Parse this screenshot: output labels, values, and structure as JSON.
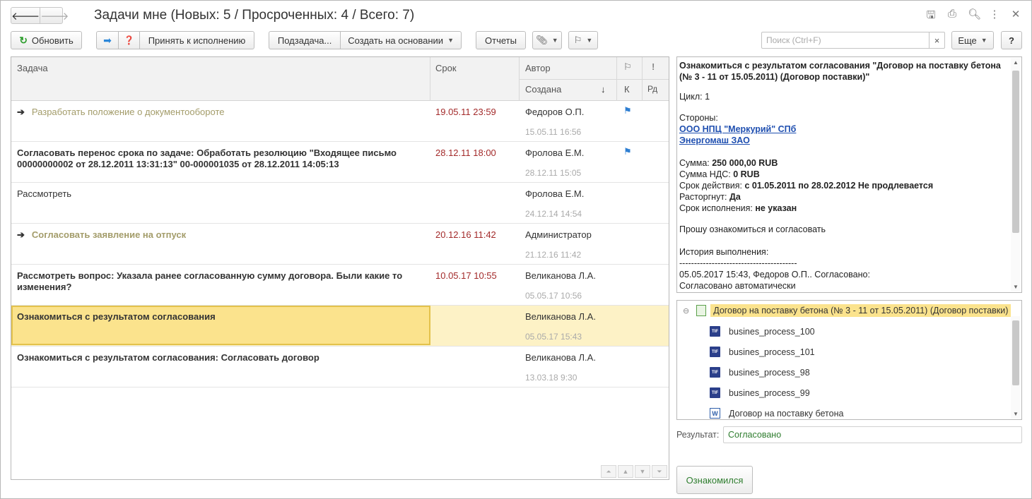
{
  "window": {
    "title": "Задачи мне (Новых: 5 / Просроченных: 4 / Всего: 7)",
    "icons": [
      "save-icon",
      "print-icon",
      "preview-icon",
      "more-vertical-icon",
      "close-icon"
    ]
  },
  "toolbar": {
    "refresh": "Обновить",
    "accept": "Принять к исполнению",
    "subtask": "Подзадача...",
    "create_based": "Создать на основании",
    "reports": "Отчеты",
    "search_placeholder": "Поиск (Ctrl+F)",
    "search_clear": "×",
    "more": "Еще",
    "help": "?"
  },
  "table": {
    "headers": {
      "task": "Задача",
      "due": "Срок",
      "author": "Автор",
      "created": "Создана",
      "sort_indicator": "↓",
      "control": "К",
      "exclaim": "!",
      "rd": "Рд"
    },
    "rows": [
      {
        "task": "Разработать положение о документообороте",
        "due": "19.05.11 23:59",
        "author": "Федоров О.П.",
        "created": "15.05.11 16:56",
        "flag": true,
        "style": "new",
        "arrow": true
      },
      {
        "task": "Согласовать перенос срока по задаче: Обработать резолюцию \"Входящее письмо 00000000002 от 28.12.2011 13:31:13\" 00-000001035 от 28.12.2011 14:05:13",
        "due": "28.12.11 18:00",
        "author": "Фролова Е.М.",
        "created": "28.12.11 15:05",
        "flag": true,
        "style": "bold",
        "arrow": false
      },
      {
        "task": "Рассмотреть",
        "due": "",
        "author": "Фролова Е.М.",
        "created": "24.12.14 14:54",
        "flag": false,
        "style": "normal",
        "arrow": false
      },
      {
        "task": "Согласовать заявление на отпуск",
        "due": "20.12.16 11:42",
        "author": "Администратор",
        "created": "21.12.16 11:42",
        "flag": false,
        "style": "newbold",
        "arrow": true
      },
      {
        "task": "Рассмотреть вопрос: Указала ранее согласованную сумму договора. Были какие то изменения?",
        "due": "10.05.17 10:55",
        "author": "Великанова Л.А.",
        "created": "05.05.17 10:56",
        "flag": false,
        "style": "bold",
        "arrow": false
      },
      {
        "task": "Ознакомиться с результатом согласования",
        "due": "",
        "author": "Великанова Л.А.",
        "created": "05.05.17 15:43",
        "flag": false,
        "style": "bold",
        "arrow": false,
        "selected": true
      },
      {
        "task": "Ознакомиться с результатом согласования: Согласовать договор",
        "due": "",
        "author": "Великанова Л.А.",
        "created": "13.03.18 9:30",
        "flag": false,
        "style": "bold",
        "arrow": false
      }
    ]
  },
  "details": {
    "title": "Ознакомиться с результатом согласования \"Договор на поставку бетона (№ 3 - 11 от 15.05.2011) (Договор поставки)\"",
    "cycle_label": "Цикл:",
    "cycle_value": "1",
    "parties_label": "Стороны:",
    "party1": "ООО НПЦ \"Меркурий\" СПб",
    "party2": "Энергомаш ЗАО",
    "sum_label": "Сумма:",
    "sum_value": "250 000,00 RUB",
    "vat_label": "Сумма НДС:",
    "vat_value": "0 RUB",
    "term_label": "Срок действия:",
    "term_value": "с 01.05.2011 по 28.02.2012 Не продлевается",
    "terminated_label": "Расторгнут:",
    "terminated_value": "Да",
    "deadline_label": "Срок исполнения:",
    "deadline_value": "не указан",
    "request": "Прошу ознакомиться и согласовать",
    "history_label": "История выполнения:",
    "separator": "----------------------------------------",
    "history_entry": "05.05.2017 15:43, Федоров О.П.. Согласовано:",
    "history_note": "Согласовано автоматически"
  },
  "files": {
    "root": "Договор на поставку бетона (№ 3 - 11 от 15.05.2011) (Договор поставки)",
    "items": [
      {
        "name": "busines_process_100",
        "icon": "tif"
      },
      {
        "name": "busines_process_101",
        "icon": "tif"
      },
      {
        "name": "busines_process_98",
        "icon": "tif"
      },
      {
        "name": "busines_process_99",
        "icon": "tif"
      },
      {
        "name": "Договор на поставку бетона",
        "icon": "word"
      }
    ]
  },
  "result": {
    "label": "Результат:",
    "value": "Согласовано"
  },
  "acknowledge_button": "Ознакомился"
}
